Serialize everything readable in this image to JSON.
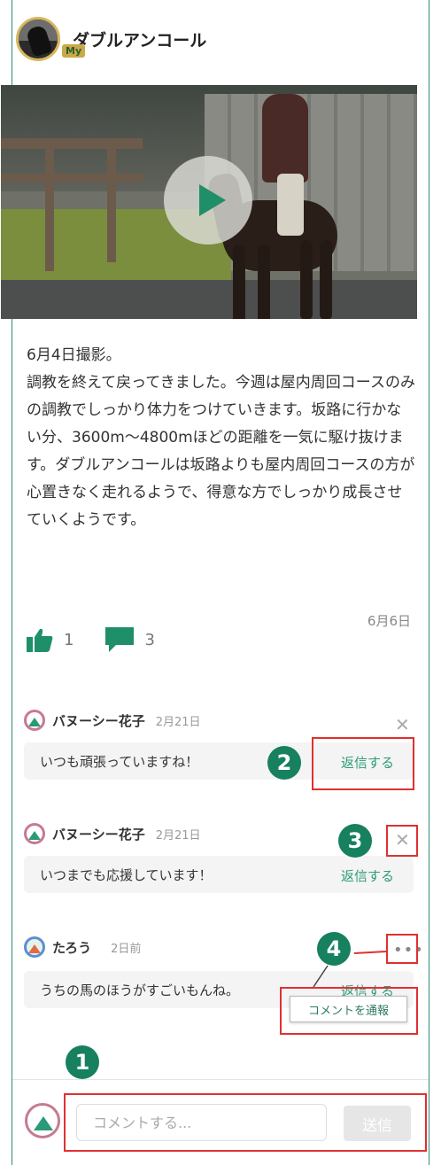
{
  "header": {
    "title": "ダブルアンコール",
    "badge": "My"
  },
  "video": {
    "logo": "",
    "logo_sub": ""
  },
  "post": {
    "line1": "6月4日撮影。",
    "body": "調教を終えて戻ってきました。今週は屋内周回コースのみの調教でしっかり体力をつけていきます。坂路に行かない分、3600m〜4800mほどの距離を一気に駆け抜けます。ダブルアンコールは坂路よりも屋内周回コースの方が心置きなく走れるようで、得意な方でしっかり成長させていくようです。",
    "date": "6月6日",
    "likes": "1",
    "comments": "3"
  },
  "comments": [
    {
      "name": "バヌーシー花子",
      "time": "2月21日",
      "text": "いつも頑張っていますね！",
      "reply": "返信する"
    },
    {
      "name": "バヌーシー花子",
      "time": "2月21日",
      "text": "いつまでも応援しています！",
      "reply": "返信する"
    },
    {
      "name": "たろう",
      "time": "2日前",
      "text": "うちの馬のほうがすごいもんね。",
      "reply": "返信する"
    }
  ],
  "report_label": "コメントを通報",
  "markers": [
    "1",
    "2",
    "3",
    "4"
  ],
  "composer": {
    "placeholder": "コメントする...",
    "send_label": "送信"
  },
  "colors": {
    "accent": "#16805f",
    "highlight": "#e03030"
  }
}
